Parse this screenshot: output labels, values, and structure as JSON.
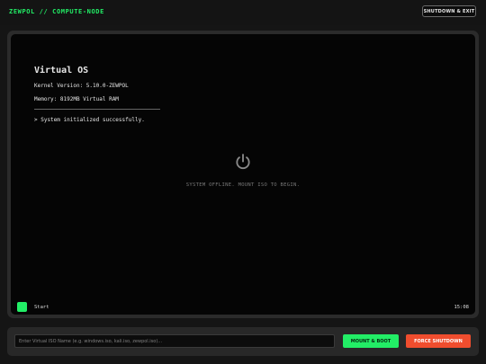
{
  "header": {
    "brand": "ZEWPOL // COMPUTE-NODE",
    "exit_label": "SHUTDOWN & EXIT"
  },
  "screen": {
    "os_title": "Virtual OS",
    "kernel": "Kernel Version: 5.10.0-ZEWPOL",
    "memory": "Memory: 8192MB Virtual RAM",
    "status": "> System initialized successfully.",
    "offline_message": "SYSTEM OFFLINE. MOUNT ISO TO BEGIN.",
    "power_icon": "power-icon",
    "taskbar": {
      "start_label": "Start",
      "clock": "15:08"
    }
  },
  "controls": {
    "iso_placeholder": "Enter Virtual ISO Name (e.g. windows.iso, kali.iso, zewpol.iso)...",
    "iso_value": "",
    "mount_label": "MOUNT & BOOT",
    "force_label": "FORCE SHUTDOWN"
  },
  "colors": {
    "accent_green": "#22ee66",
    "danger_red": "#f04d2e",
    "background": "#151515"
  }
}
